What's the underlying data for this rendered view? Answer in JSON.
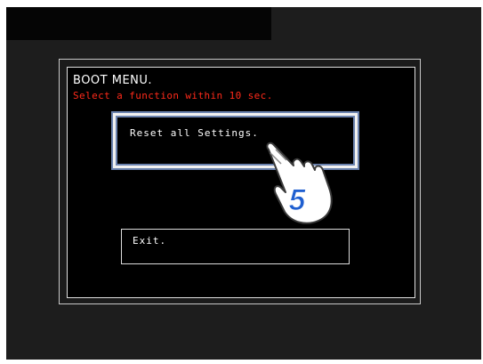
{
  "boot_menu": {
    "title": "BOOT MENU.",
    "subtitle": "Select a function within 10 sec.",
    "options": [
      {
        "label": "Reset all Settings.",
        "selected": true
      },
      {
        "label": "Exit.",
        "selected": false
      }
    ]
  },
  "callout": {
    "step_number": "5",
    "icon": "pointing-hand-icon"
  },
  "colors": {
    "background": "#1d1d1d",
    "title_text": "#ffffff",
    "subtitle_text": "#ff2a1a",
    "selection_highlight": "#6a82ae",
    "step_number": "#1f5fd0"
  }
}
